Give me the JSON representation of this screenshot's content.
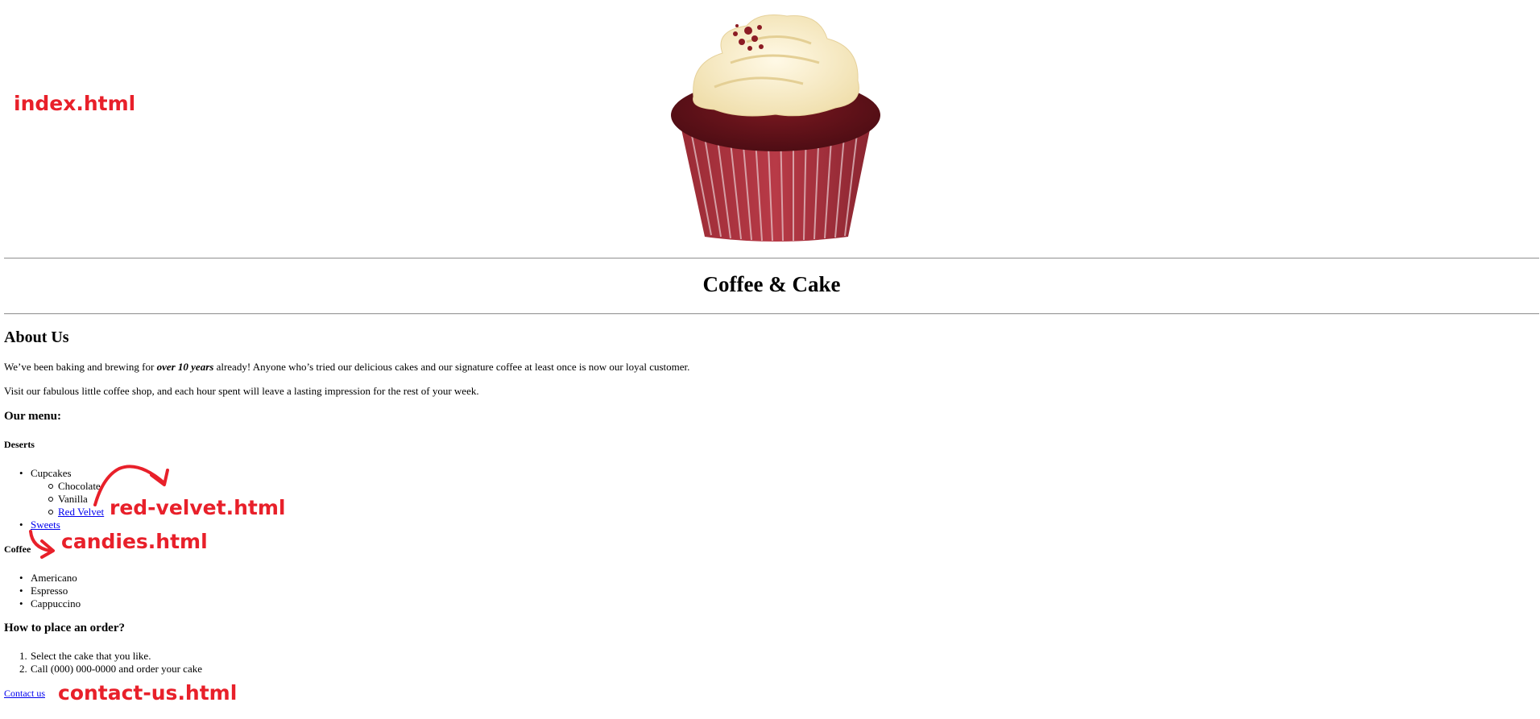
{
  "site_title": "Coffee & Cake",
  "hero_image": {
    "subject": "red velvet cupcake with cream cheese frosting"
  },
  "about": {
    "heading": "About Us",
    "p1_before": "We’ve been baking and brewing for ",
    "p1_emph": "over 10 years",
    "p1_after": " already! Anyone who’s tried our delicious cakes and our signature coffee at least once is now our loyal customer.",
    "p2": "Visit our fabulous little coffee shop, and each hour spent will leave a lasting impression for the rest of your week."
  },
  "menu": {
    "heading": "Our menu:",
    "deserts_heading": "Deserts",
    "cupcakes_label": "Cupcakes",
    "cupcakes": [
      "Chocolate",
      "Vanilla",
      "Red Velvet"
    ],
    "sweets_label": "Sweets",
    "coffee_heading": "Coffee",
    "coffee": [
      "Americano",
      "Espresso",
      "Cappuccino"
    ]
  },
  "order": {
    "heading": "How to place an order?",
    "steps": [
      "Select the cake that you like.",
      "Call (000) 000-0000 and order your cake"
    ]
  },
  "contact_link": "Contact us",
  "annotations": {
    "index": "index.html",
    "red_velvet": "red-velvet.html",
    "candies": "candies.html",
    "contact": "contact-us.html",
    "color": "#e8202a"
  },
  "colors": {
    "link": "#0000ee",
    "text": "#000000",
    "background": "#ffffff"
  }
}
